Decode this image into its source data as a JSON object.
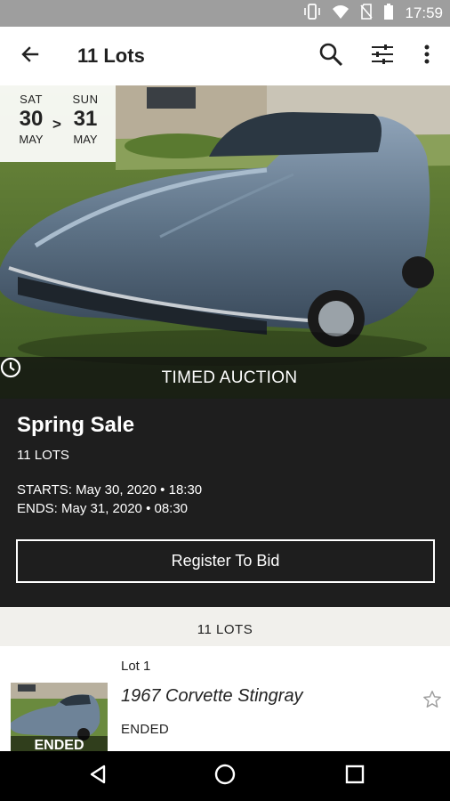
{
  "status_bar": {
    "time": "17:59",
    "icons": [
      "vibrate-icon",
      "wifi-icon",
      "no-sim-icon",
      "battery-icon"
    ]
  },
  "app_bar": {
    "title": "11 Lots",
    "icons": [
      "back-arrow-icon",
      "search-icon",
      "filter-sliders-icon",
      "overflow-menu-icon"
    ]
  },
  "hero": {
    "date_start": {
      "dow": "SAT",
      "day": "30",
      "month": "MAY"
    },
    "date_separator": ">",
    "date_end": {
      "dow": "SUN",
      "day": "31",
      "month": "MAY"
    },
    "banner_label": "TIMED AUCTION",
    "banner_icon": "clock-icon"
  },
  "sale": {
    "title": "Spring Sale",
    "lots_count": "11 LOTS",
    "starts": "STARTS: May 30, 2020 • 18:30",
    "ends": "ENDS: May 31, 2020 • 08:30",
    "register_label": "Register To Bid"
  },
  "lots": {
    "header": "11 LOTS",
    "items": [
      {
        "number": "Lot 1",
        "name": "1967 Corvette Stingray",
        "status": "ENDED",
        "thumb_label": "ENDED",
        "star_icon": "star-outline-icon"
      }
    ]
  },
  "nav_bar": {
    "icons": [
      "back-triangle-icon",
      "home-circle-icon",
      "recents-square-icon"
    ]
  },
  "colors": {
    "status_bar": "#9e9e9e",
    "app_bar": "#ffffff",
    "info_bg": "#1e1e1e",
    "lots_bg": "#f1f0ec",
    "nav_bar": "#000000"
  }
}
